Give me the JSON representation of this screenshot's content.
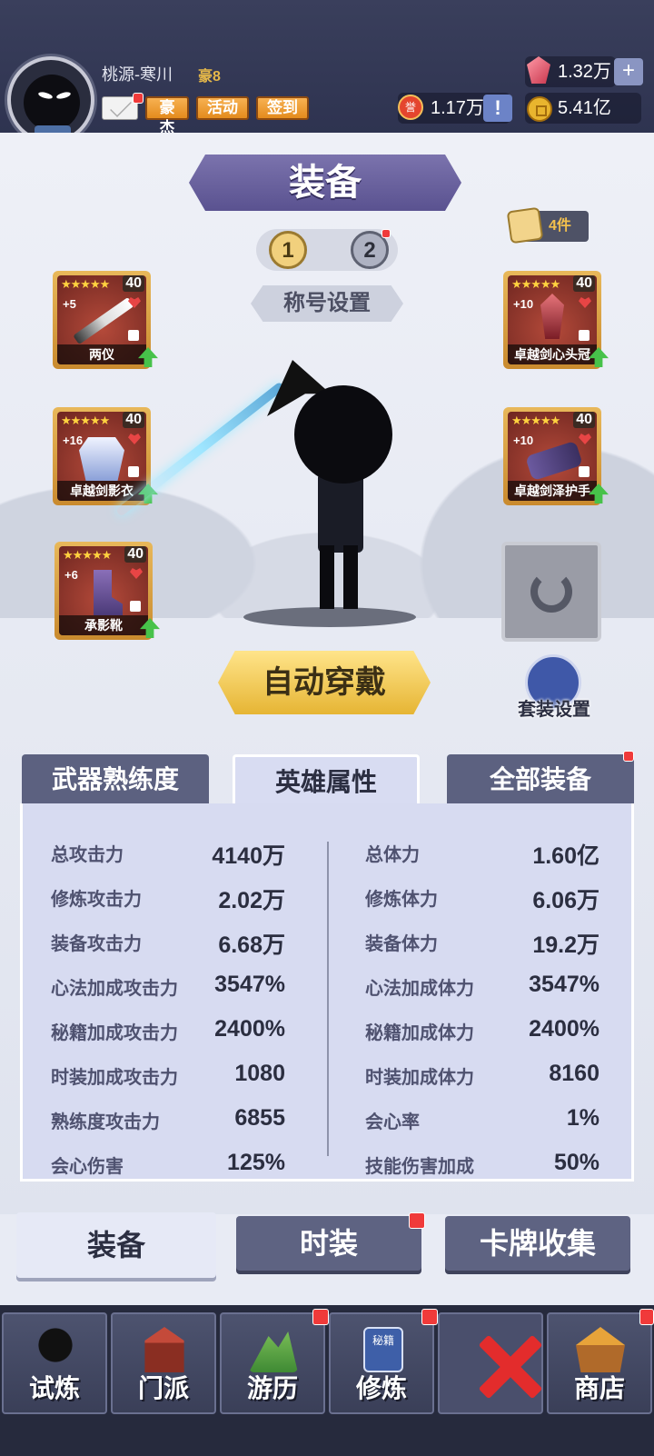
{
  "header": {
    "username": "桃源-寒川",
    "vip": "豪8",
    "buttons": [
      "豪杰",
      "活动",
      "签到"
    ],
    "gems": "1.32万",
    "honor": "1.17万",
    "gold": "5.41亿",
    "honor_icon_text": "誉"
  },
  "page": {
    "title": "装备",
    "set_1": "1",
    "set_2": "2",
    "title_setting": "称号设置",
    "item_count": "4件",
    "auto_equip": "自动穿戴",
    "suit_setting": "套装设置"
  },
  "slots": [
    {
      "name": "两仪",
      "level": "40",
      "plus": "+5",
      "stars": "★★★★★",
      "icon": "sword-icon"
    },
    {
      "name": "卓越剑影衣",
      "level": "40",
      "plus": "+16",
      "stars": "★★★★★",
      "icon": "robe-icon"
    },
    {
      "name": "承影靴",
      "level": "40",
      "plus": "+6",
      "stars": "★★★★★",
      "icon": "boots-icon"
    },
    {
      "name": "卓越剑心头冠",
      "level": "40",
      "plus": "+10",
      "stars": "★★★★★",
      "icon": "crown-icon"
    },
    {
      "name": "卓越剑泽护手",
      "level": "40",
      "plus": "+10",
      "stars": "★★★★★",
      "icon": "bracer-icon"
    }
  ],
  "tabs": [
    "武器熟练度",
    "英雄属性",
    "全部装备"
  ],
  "stats_left": [
    {
      "label": "总攻击力",
      "value": "4140万"
    },
    {
      "label": "修炼攻击力",
      "value": "2.02万"
    },
    {
      "label": "装备攻击力",
      "value": "6.68万"
    },
    {
      "label": "心法加成攻击力",
      "value": "3547%"
    },
    {
      "label": "秘籍加成攻击力",
      "value": "2400%"
    },
    {
      "label": "时装加成攻击力",
      "value": "1080"
    },
    {
      "label": "熟练度攻击力",
      "value": "6855"
    },
    {
      "label": "会心伤害",
      "value": "125%"
    }
  ],
  "stats_right": [
    {
      "label": "总体力",
      "value": "1.60亿"
    },
    {
      "label": "修炼体力",
      "value": "6.06万"
    },
    {
      "label": "装备体力",
      "value": "19.2万"
    },
    {
      "label": "心法加成体力",
      "value": "3547%"
    },
    {
      "label": "秘籍加成体力",
      "value": "2400%"
    },
    {
      "label": "时装加成体力",
      "value": "8160"
    },
    {
      "label": "会心率",
      "value": "1%"
    },
    {
      "label": "技能伤害加成",
      "value": "50%"
    }
  ],
  "subtabs": [
    "装备",
    "时装",
    "卡牌收集"
  ],
  "nav": [
    {
      "label": "试炼",
      "icon": "ninja-icon"
    },
    {
      "label": "门派",
      "icon": "temple-icon"
    },
    {
      "label": "游历",
      "icon": "mountain-icon"
    },
    {
      "label": "修炼",
      "icon": "book-icon",
      "art_text": "秘籍"
    },
    {
      "label": "",
      "icon": "close-icon"
    },
    {
      "label": "商店",
      "icon": "shop-icon"
    }
  ],
  "colors": {
    "accent_purple": "#5a5290",
    "gold": "#e6b534",
    "badge_red": "#f03a3a",
    "nav_bg": "#262a3d"
  }
}
